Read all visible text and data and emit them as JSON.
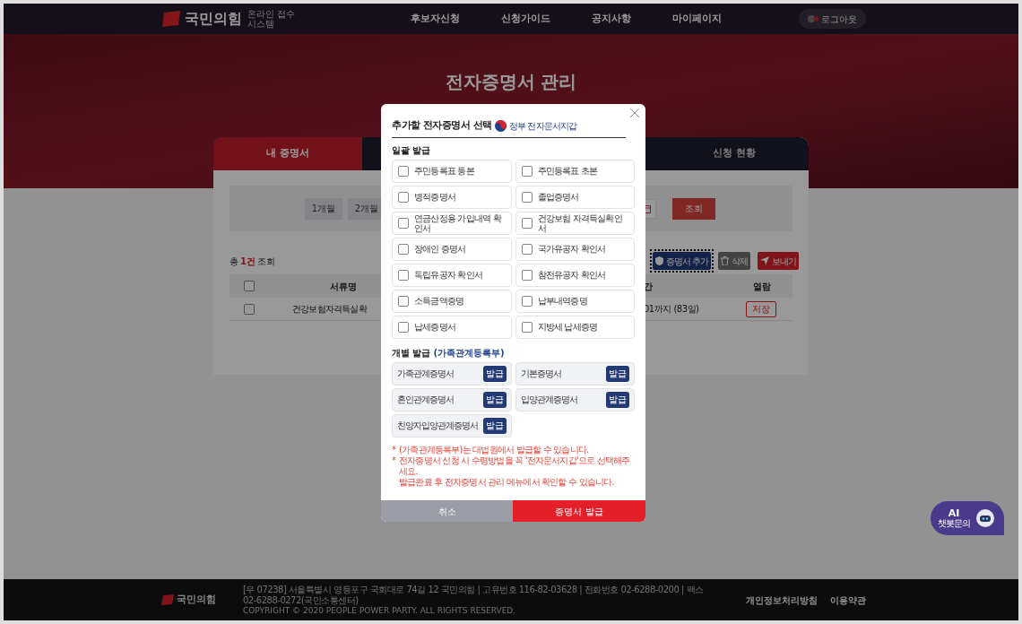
{
  "header": {
    "logo": "국민의힘",
    "logo_sub": "온라인 접수 시스템",
    "nav": [
      "후보자신청",
      "신청가이드",
      "공지사항",
      "마이페이지"
    ],
    "logout": "로그아웃"
  },
  "hero": {
    "title": "전자증명서 관리"
  },
  "tabs": [
    {
      "label": "내 증명서",
      "selected": true
    },
    {
      "label": "신청 현황",
      "selected": false
    }
  ],
  "filters": {
    "periods": [
      "1개월",
      "2개월"
    ],
    "search_button": "조회"
  },
  "count": {
    "prefix": "총",
    "number": "1건",
    "suffix": "조회"
  },
  "actions": [
    {
      "kind": "add",
      "label": "증명서 추가",
      "focused": true
    },
    {
      "kind": "delete",
      "label": "삭제",
      "focused": false
    },
    {
      "kind": "send",
      "label": "보내기",
      "focused": false
    }
  ],
  "table": {
    "header_checked": false,
    "columns": [
      "서류명",
      "간",
      "열람"
    ],
    "rows": [
      {
        "checked": false,
        "name": "건강보험자격득실확",
        "period": "01까지 (83일)",
        "action": "저장"
      }
    ]
  },
  "modal": {
    "title": "추가할 전자증명서 선택",
    "brand": "정부 전자문서지갑",
    "batch_title": "일괄 발급",
    "batch_items": [
      {
        "label": "주민등록표 등본",
        "checked": false
      },
      {
        "label": "주민등록표 초본",
        "checked": false
      },
      {
        "label": "병적증명서",
        "checked": false
      },
      {
        "label": "졸업증명서",
        "checked": false
      },
      {
        "label": "연금산정용 가입내역 확인서",
        "checked": false
      },
      {
        "label": "건강보험 자격득실확인서",
        "checked": false
      },
      {
        "label": "장애인 증명서",
        "checked": false
      },
      {
        "label": "국가유공자 확인서",
        "checked": false
      },
      {
        "label": "독립유공자 확인서",
        "checked": false
      },
      {
        "label": "참전유공자 확인서",
        "checked": false
      },
      {
        "label": "소득금액증명",
        "checked": false
      },
      {
        "label": "납부내역증명",
        "checked": false
      },
      {
        "label": "납세증명서",
        "checked": false
      },
      {
        "label": "지방세 납세증명",
        "checked": false
      }
    ],
    "individual_title": "개별 발급",
    "individual_note": "(가족관계등록부)",
    "individual_items": [
      {
        "label": "가족관계증명서",
        "button": "발급"
      },
      {
        "label": "기본증명서",
        "button": "발급"
      },
      {
        "label": "혼인관계증명서",
        "button": "발급"
      },
      {
        "label": "입양관계증명서",
        "button": "발급"
      },
      {
        "label": "친양자입양관계증명서",
        "button": "발급"
      }
    ],
    "notes": [
      {
        "bullet": "*",
        "text": "(가족관계등록부)는 대법원에서 발급할 수 있습니다."
      },
      {
        "bullet": "*",
        "text": "전자증명서 신청 시 수령방법을 꼭 '전자문서지갑'으로 선택해주세요."
      },
      {
        "text": "발급완료 후 전자증명서 관리 메뉴에서 확인할 수 있습니다."
      }
    ],
    "cancel": "취소",
    "submit": "증명서 발급"
  },
  "chatbot": {
    "title": "AI",
    "label": "챗봇문의"
  },
  "footer": {
    "logo": "국민의힘",
    "address": "[우 07238] 서울특별시 영등포구 국회대로 74길 12 국민의힘 | 고유번호 116-82-03628 | 전화번호 02-6288-0200 | 팩스 02-6288-0272(국민소통센터)",
    "copyright": "COPYRIGHT © 2020 PEOPLE POWER PARTY. ALL RIGHTS RESERVED.",
    "links": [
      "개인정보처리방침",
      "이용약관"
    ]
  }
}
